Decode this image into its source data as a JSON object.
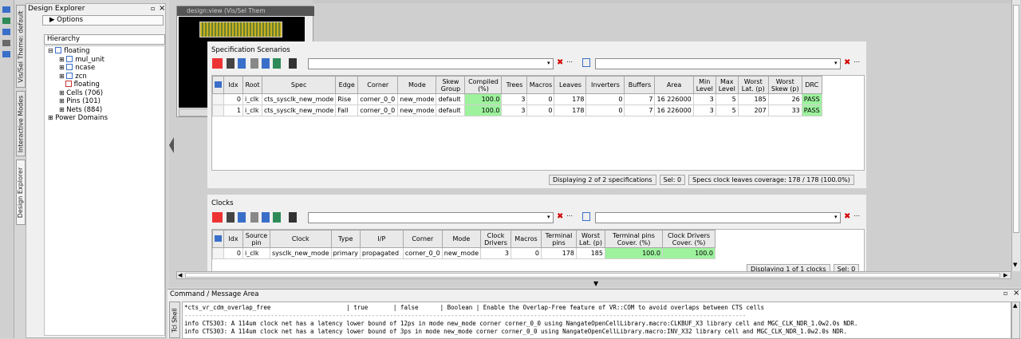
{
  "left_tabs": [
    "Vis/Sel Theme: default",
    "Interactive Modes",
    "Design Explorer"
  ],
  "explorer": {
    "title": "Design Explorer",
    "float_btn": "ꟹ",
    "close_btn": "×",
    "options_label": "Options",
    "hierarchy_label": "Hierarchy",
    "tree": [
      {
        "label": "floating",
        "indent": 0,
        "sign": "⊟",
        "icon": "module-icon"
      },
      {
        "label": "mul_unit",
        "indent": 1,
        "sign": "⊞",
        "icon": "module-icon"
      },
      {
        "label": "ncase",
        "indent": 1,
        "sign": "⊞",
        "icon": "module-icon"
      },
      {
        "label": "zcn",
        "indent": 1,
        "sign": "⊞",
        "icon": "module-icon"
      },
      {
        "label": "floating",
        "indent": 1,
        "sign": "",
        "icon": "module-red-icon"
      },
      {
        "label": "Cells (706)",
        "indent": 1,
        "sign": "⊞",
        "icon": ""
      },
      {
        "label": "Pins (101)",
        "indent": 1,
        "sign": "⊞",
        "icon": ""
      },
      {
        "label": "Nets (884)",
        "indent": 1,
        "sign": "⊞",
        "icon": ""
      },
      {
        "label": "Power Domains",
        "indent": 0,
        "sign": "⊞",
        "icon": ""
      }
    ]
  },
  "design_view": {
    "title": "design:view  (Vis/Sel Them"
  },
  "spec": {
    "title": "Specification Scenarios",
    "columns": [
      "Idx",
      "Root",
      "Spec",
      "Edge",
      "Corner",
      "Mode",
      "Skew Group",
      "Compiled (%)",
      "Trees",
      "Macros",
      "Leaves",
      "Inverters",
      "Buffers",
      "Area",
      "Min Level",
      "Max Level",
      "Worst Lat. (p)",
      "Worst Skew (p)",
      "DRC"
    ],
    "rows": [
      [
        "0",
        "i_clk",
        "cts_sysclk_new_mode",
        "Rise",
        "corner_0_0",
        "new_mode",
        "default",
        "100.0",
        "3",
        "0",
        "178",
        "0",
        "7",
        "16 226000",
        "3",
        "5",
        "185",
        "26",
        "PASS"
      ],
      [
        "1",
        "i_clk",
        "cts_sysclk_new_mode",
        "Fall",
        "corner_0_0",
        "new_mode",
        "default",
        "100.0",
        "3",
        "0",
        "178",
        "0",
        "7",
        "16 226000",
        "3",
        "5",
        "207",
        "33",
        "PASS"
      ]
    ],
    "status": [
      "Displaying 2 of 2 specifications",
      "Sel: 0",
      "Specs clock leaves coverage: 178 / 178 (100.0%)"
    ]
  },
  "clocks": {
    "title": "Clocks",
    "columns": [
      "Idx",
      "Source pin",
      "Clock",
      "Type",
      "I/P",
      "Corner",
      "Mode",
      "Clock Drivers",
      "Macros",
      "Terminal pins",
      "Worst Lat. (p)",
      "Terminal pins Cover. (%)",
      "Clock Drivers Cover. (%)"
    ],
    "rows": [
      [
        "0",
        "i_clk",
        "sysclk_new_mode",
        "primary",
        "propagated",
        "corner_0_0",
        "new_mode",
        "3",
        "0",
        "178",
        "185",
        "100.0",
        "100.0"
      ]
    ],
    "status": [
      "Displaying 1 of 1 clocks",
      "Sel: 0"
    ]
  },
  "console": {
    "title": "Command / Message Area",
    "tab": "Tcl Shell",
    "lines": [
      "*cts_vr_cdm_overlap_free                     | true       | false      | Boolean | Enable the Overlap-Free feature of VR::COM to avoid overlaps between CTS cells",
      "------------------------------------------------------------------------------------------------------------------------------------------------------------",
      "info CTS303: A 114um clock net has a latency lower bound of 12ps in mode new_mode corner corner_0_0 using NangateOpenCellLibrary.macro:CLKBUF_X3 library cell and MGC_CLK_NDR_1.0w2.0s NDR.",
      "info CTS303: A 114um clock net has a latency lower bound of 3ps in mode new_mode corner corner_0_0 using NangateOpenCellLibrary.macro:INV_X32 library cell and MGC_CLK_NDR_1.0w2.0s NDR."
    ]
  },
  "colors": {
    "pass": "#9ef29e",
    "accent": "#3a6fc9"
  }
}
